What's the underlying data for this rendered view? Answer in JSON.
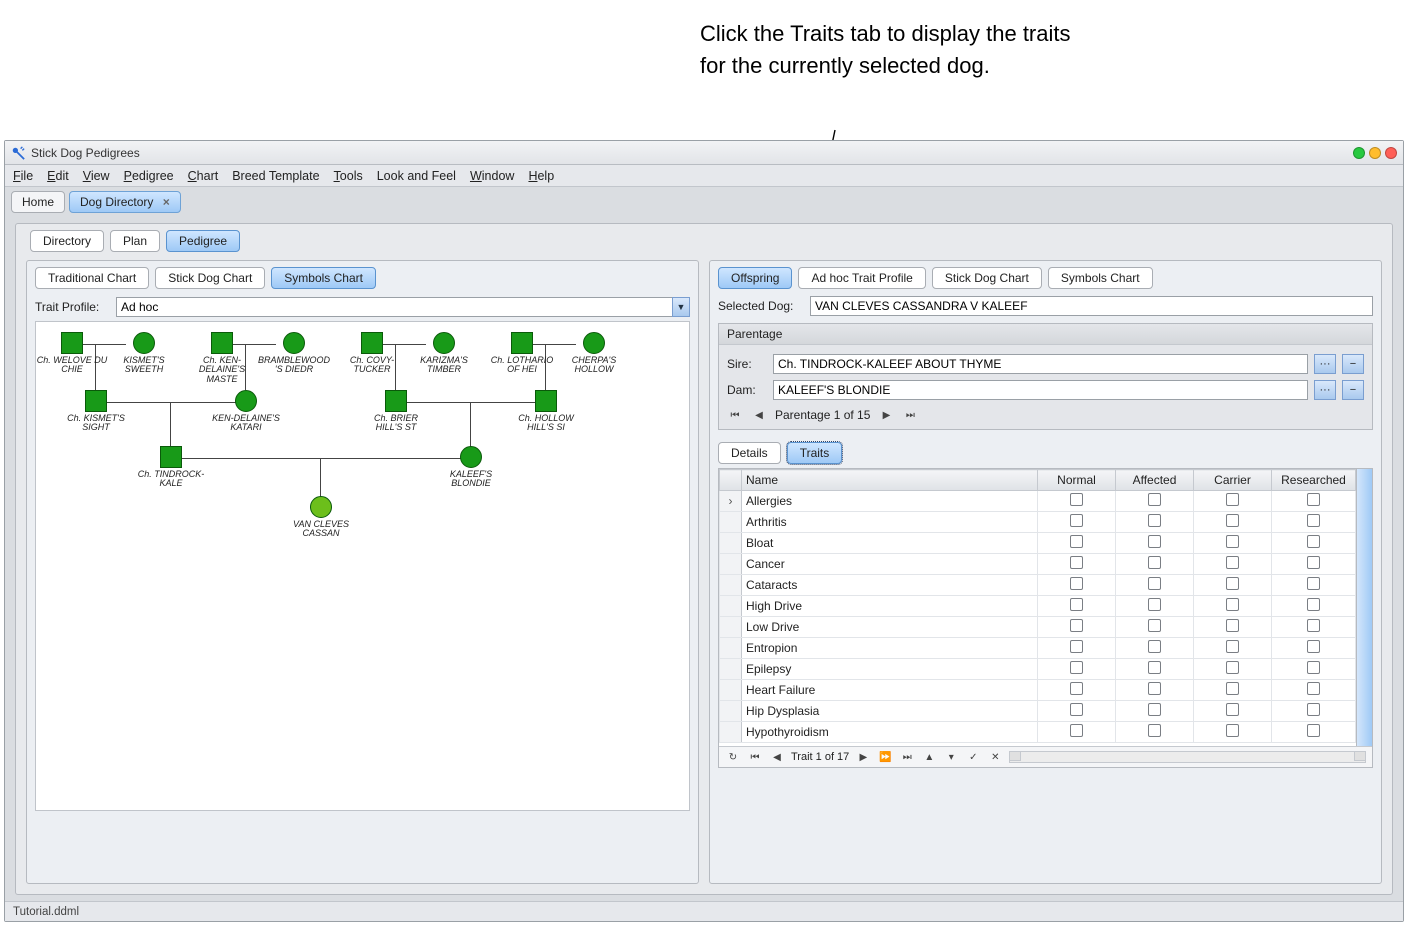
{
  "callout": "Click the Traits tab to display the traits for the currently selected dog.",
  "window": {
    "title": "Stick Dog Pedigrees"
  },
  "menubar": [
    "File",
    "Edit",
    "View",
    "Pedigree",
    "Chart",
    "Breed Template",
    "Tools",
    "Look and Feel",
    "Window",
    "Help"
  ],
  "docTabs": {
    "home": "Home",
    "directory": "Dog Directory"
  },
  "viewTabs": {
    "directory": "Directory",
    "plan": "Plan",
    "pedigree": "Pedigree"
  },
  "chartTabs": {
    "traditional": "Traditional Chart",
    "stickdog": "Stick Dog Chart",
    "symbols": "Symbols Chart"
  },
  "traitProfile": {
    "label": "Trait Profile:",
    "value": "Ad hoc"
  },
  "pedigreeNodes": {
    "n1": "Ch. WELOVE DU CHIE",
    "n2": "KISMET'S SWEETH",
    "n3": "Ch. KEN-DELAINE'S MASTE",
    "n4": "BRAMBLEWOOD'S DIEDR",
    "n5": "Ch. COVY-TUCKER",
    "n6": "KARIZMA'S TIMBER",
    "n7": "Ch. LOTHARIO OF HEI",
    "n8": "CHERPA'S HOLLOW",
    "n9": "Ch. KISMET'S SIGHT",
    "n10": "KEN-DELAINE'S KATARI",
    "n11": "Ch. BRIER HILL'S ST",
    "n12": "Ch. HOLLOW HILL'S SI",
    "n13": "Ch. TINDROCK-KALE",
    "n14": "KALEEF'S BLONDIE",
    "n15": "VAN CLEVES CASSAN"
  },
  "rightTabs": {
    "offspring": "Offspring",
    "adhoc": "Ad hoc Trait Profile",
    "stickdog": "Stick Dog Chart",
    "symbols": "Symbols Chart"
  },
  "selectedDog": {
    "label": "Selected Dog:",
    "value": "VAN CLEVES CASSANDRA V KALEEF"
  },
  "parentage": {
    "title": "Parentage",
    "sireLabel": "Sire:",
    "sireValue": "Ch. TINDROCK-KALEEF ABOUT THYME",
    "damLabel": "Dam:",
    "damValue": "KALEEF'S BLONDIE",
    "navText": "Parentage 1 of 15"
  },
  "detailTabs": {
    "details": "Details",
    "traits": "Traits"
  },
  "traitsGrid": {
    "headers": {
      "name": "Name",
      "normal": "Normal",
      "affected": "Affected",
      "carrier": "Carrier",
      "researched": "Researched"
    },
    "rows": [
      "Allergies",
      "Arthritis",
      "Bloat",
      "Cancer",
      "Cataracts",
      "High Drive",
      "Low Drive",
      "Entropion",
      "Epilepsy",
      "Heart Failure",
      "Hip Dysplasia",
      "Hypothyroidism"
    ],
    "navText": "Trait 1 of 17"
  },
  "statusBar": "Tutorial.ddml"
}
